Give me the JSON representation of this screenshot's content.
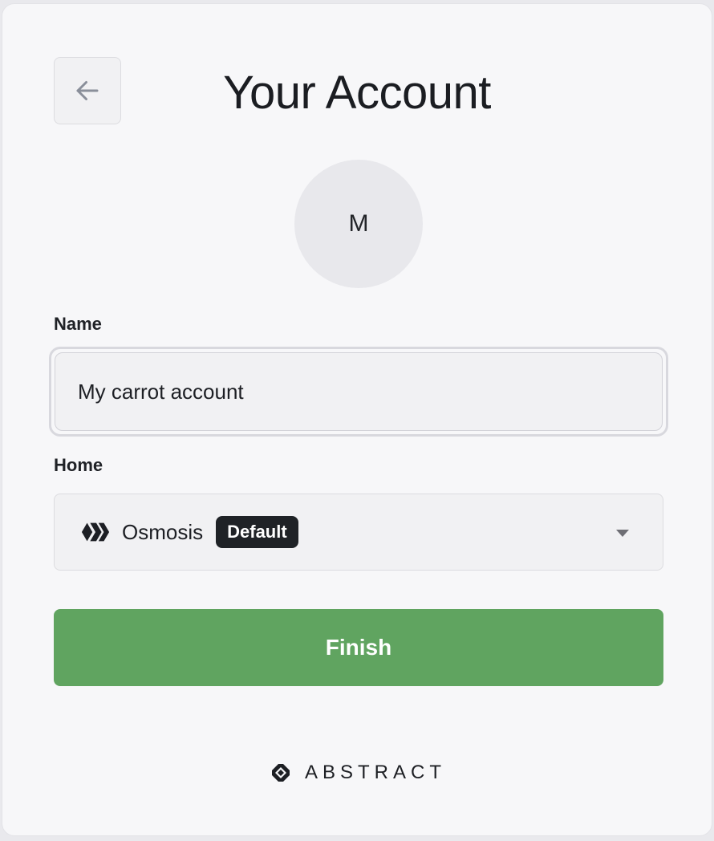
{
  "header": {
    "title": "Your Account",
    "back_icon": "arrow-left-icon"
  },
  "avatar": {
    "initial": "M"
  },
  "form": {
    "name_label": "Name",
    "name_value": "My carrot account",
    "home_label": "Home",
    "home_value": "Osmosis",
    "home_badge": "Default",
    "home_icon": "osmosis-logo-icon",
    "dropdown_icon": "caret-down-icon"
  },
  "actions": {
    "finish_label": "Finish"
  },
  "footer": {
    "brand_name": "ABSTRACT",
    "brand_icon": "abstract-logo-icon"
  },
  "colors": {
    "primary_button": "#60a460",
    "badge_background": "#1f2226",
    "card_background": "#f7f7f9"
  }
}
